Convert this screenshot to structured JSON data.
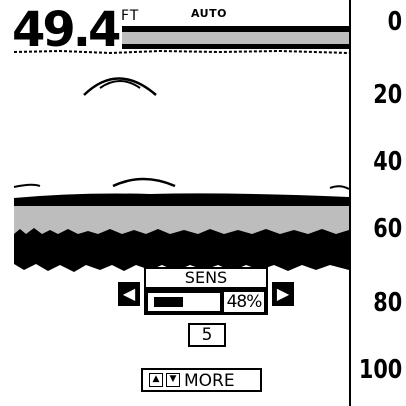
{
  "readout": {
    "depth": "49.4",
    "unit": "FT",
    "mode": "AUTO"
  },
  "depth_scale": [
    "0",
    "20",
    "40",
    "60",
    "80",
    "100"
  ],
  "sens_popup": {
    "title": "SENS",
    "left_arrow_icon": "left-arrow-icon",
    "right_arrow_icon": "right-arrow-icon",
    "percent": "48%",
    "level_fraction": 0.48,
    "value": "5"
  },
  "footer": {
    "up_icon": "up-arrow-icon",
    "down_icon": "down-arrow-icon",
    "more_label": "MORE"
  }
}
